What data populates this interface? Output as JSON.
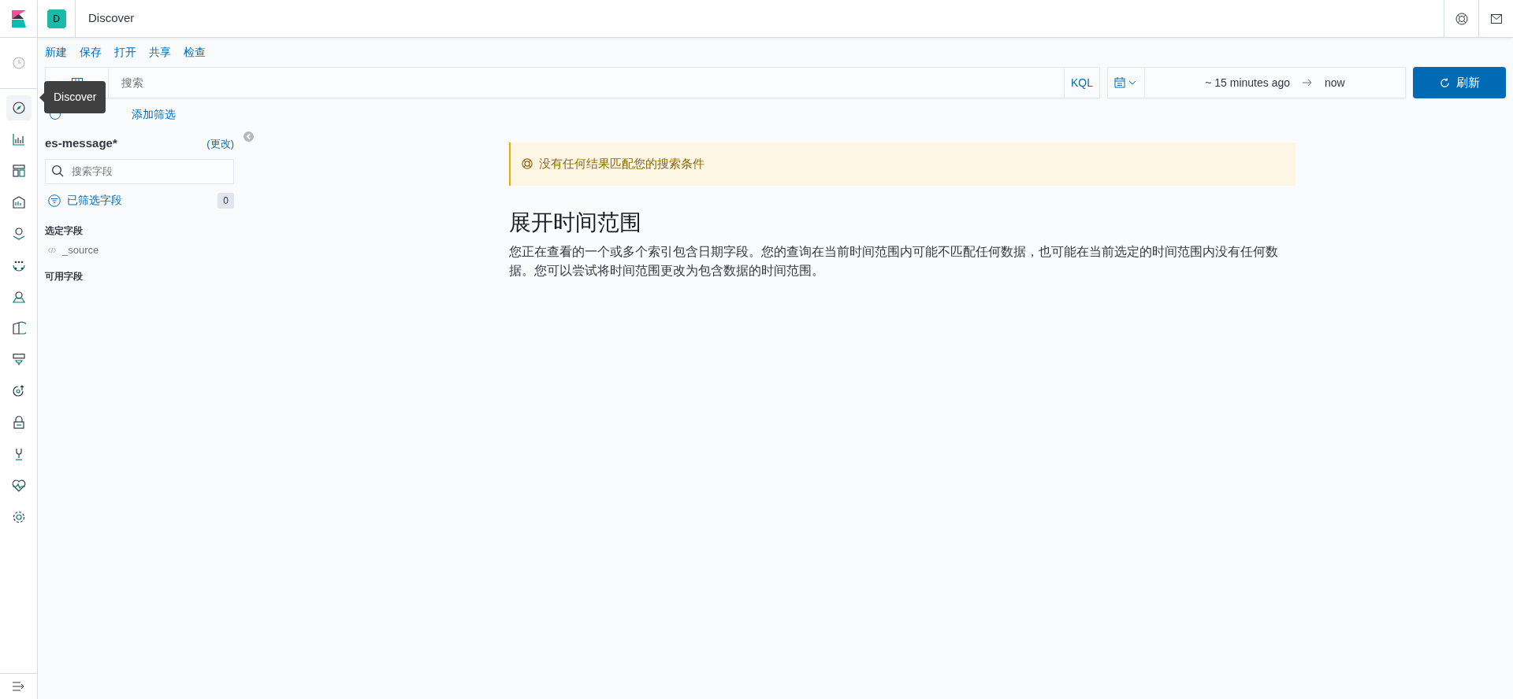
{
  "header": {
    "space_initial": "D",
    "title": "Discover"
  },
  "nav": [
    {
      "kind": "clock",
      "selected": false
    },
    {
      "kind": "compass",
      "selected": true
    },
    {
      "kind": "chart",
      "selected": false
    },
    {
      "kind": "dashboard",
      "selected": false
    },
    {
      "kind": "canvas",
      "selected": false
    },
    {
      "kind": "map",
      "selected": false
    },
    {
      "kind": "ml",
      "selected": false
    },
    {
      "kind": "infra",
      "selected": false
    },
    {
      "kind": "logs",
      "selected": false
    },
    {
      "kind": "apm",
      "selected": false
    },
    {
      "kind": "uptime",
      "selected": false
    },
    {
      "kind": "siem",
      "selected": false
    },
    {
      "kind": "devtools",
      "selected": false
    },
    {
      "kind": "monitoring",
      "selected": false
    },
    {
      "kind": "settings",
      "selected": false
    }
  ],
  "tooltip": "Discover",
  "top_menu": [
    "新建",
    "保存",
    "打开",
    "共享",
    "检查"
  ],
  "query": {
    "placeholder": "搜索",
    "language": "KQL"
  },
  "time": {
    "start": "~ 15 minutes ago",
    "end": "now"
  },
  "refresh_button": "刷新",
  "add_filter": "添加筛选",
  "sidebar": {
    "index_pattern": "es-message*",
    "change_link": "(更改)",
    "search": {
      "placeholder": "搜索字段"
    },
    "filtered_fields": "已筛选字段",
    "filtered_count": "0",
    "selected_heading": "选定字段",
    "selected_fields": [
      "_source"
    ],
    "available_heading": "可用字段"
  },
  "callout": "没有任何结果匹配您的搜索条件",
  "heading": "展开时间范围",
  "message": "您正在查看的一个或多个索引包含日期字段。您的查询在当前时间范围内可能不匹配任何数据，也可能在当前选定的时间范围内没有任何数据。您可以尝试将时间范围更改为包含数据的时间范围。"
}
